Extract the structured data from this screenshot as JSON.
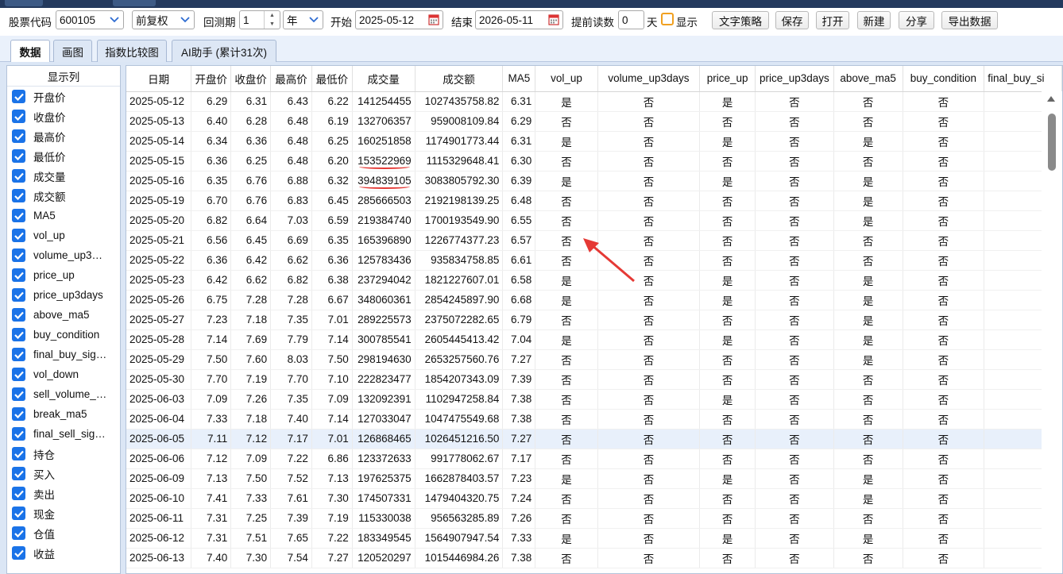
{
  "toolbar": {
    "stock_code_label": "股票代码",
    "stock_code_value": "600105",
    "adjust_value": "前复权",
    "period_label": "回测期",
    "period_num": "1",
    "period_unit": "年",
    "start_label": "开始",
    "start_date": "2025-05-12",
    "end_label": "结束",
    "end_date": "2026-05-11",
    "preread_label": "提前读数",
    "preread_value": "0",
    "day_label": "天",
    "show_label": "显示",
    "buttons": [
      "文字策略",
      "保存",
      "打开",
      "新建",
      "分享",
      "导出数据"
    ]
  },
  "tabs": [
    "数据",
    "画图",
    "指数比较图",
    "AI助手 (累计31次)"
  ],
  "sidebar": {
    "header": "显示列",
    "items": [
      "开盘价",
      "收盘价",
      "最高价",
      "最低价",
      "成交量",
      "成交额",
      "MA5",
      "vol_up",
      "volume_up3…",
      "price_up",
      "price_up3days",
      "above_ma5",
      "buy_condition",
      "final_buy_sig…",
      "vol_down",
      "sell_volume_…",
      "break_ma5",
      "final_sell_sig…",
      "持仓",
      "买入",
      "卖出",
      "现金",
      "仓值",
      "收益"
    ]
  },
  "table": {
    "headers": [
      "日期",
      "开盘价",
      "收盘价",
      "最高价",
      "最低价",
      "成交量",
      "成交额",
      "MA5",
      "vol_up",
      "volume_up3days",
      "price_up",
      "price_up3days",
      "above_ma5",
      "buy_condition",
      "final_buy_si"
    ],
    "rows": [
      [
        "2025-05-12",
        "6.29",
        "6.31",
        "6.43",
        "6.22",
        "141254455",
        "1027435758.82",
        "6.31",
        "是",
        "否",
        "是",
        "否",
        "否",
        "否"
      ],
      [
        "2025-05-13",
        "6.40",
        "6.28",
        "6.48",
        "6.19",
        "132706357",
        "959008109.84",
        "6.29",
        "否",
        "否",
        "否",
        "否",
        "否",
        "否"
      ],
      [
        "2025-05-14",
        "6.34",
        "6.36",
        "6.48",
        "6.25",
        "160251858",
        "1174901773.44",
        "6.31",
        "是",
        "否",
        "是",
        "否",
        "是",
        "否"
      ],
      [
        "2025-05-15",
        "6.36",
        "6.25",
        "6.48",
        "6.20",
        "153522969",
        "1115329648.41",
        "6.30",
        "否",
        "否",
        "否",
        "否",
        "否",
        "否"
      ],
      [
        "2025-05-16",
        "6.35",
        "6.76",
        "6.88",
        "6.32",
        "394839105",
        "3083805792.30",
        "6.39",
        "是",
        "否",
        "是",
        "否",
        "是",
        "否"
      ],
      [
        "2025-05-19",
        "6.70",
        "6.76",
        "6.83",
        "6.45",
        "285666503",
        "2192198139.25",
        "6.48",
        "否",
        "否",
        "否",
        "否",
        "是",
        "否"
      ],
      [
        "2025-05-20",
        "6.82",
        "6.64",
        "7.03",
        "6.59",
        "219384740",
        "1700193549.90",
        "6.55",
        "否",
        "否",
        "否",
        "否",
        "是",
        "否"
      ],
      [
        "2025-05-21",
        "6.56",
        "6.45",
        "6.69",
        "6.35",
        "165396890",
        "1226774377.23",
        "6.57",
        "否",
        "否",
        "否",
        "否",
        "否",
        "否"
      ],
      [
        "2025-05-22",
        "6.36",
        "6.42",
        "6.62",
        "6.36",
        "125783436",
        "935834758.85",
        "6.61",
        "否",
        "否",
        "否",
        "否",
        "否",
        "否"
      ],
      [
        "2025-05-23",
        "6.42",
        "6.62",
        "6.82",
        "6.38",
        "237294042",
        "1821227607.01",
        "6.58",
        "是",
        "否",
        "是",
        "否",
        "是",
        "否"
      ],
      [
        "2025-05-26",
        "6.75",
        "7.28",
        "7.28",
        "6.67",
        "348060361",
        "2854245897.90",
        "6.68",
        "是",
        "否",
        "是",
        "否",
        "是",
        "否"
      ],
      [
        "2025-05-27",
        "7.23",
        "7.18",
        "7.35",
        "7.01",
        "289225573",
        "2375072282.65",
        "6.79",
        "否",
        "否",
        "否",
        "否",
        "是",
        "否"
      ],
      [
        "2025-05-28",
        "7.14",
        "7.69",
        "7.79",
        "7.14",
        "300785541",
        "2605445413.42",
        "7.04",
        "是",
        "否",
        "是",
        "否",
        "是",
        "否"
      ],
      [
        "2025-05-29",
        "7.50",
        "7.60",
        "8.03",
        "7.50",
        "298194630",
        "2653257560.76",
        "7.27",
        "否",
        "否",
        "否",
        "否",
        "是",
        "否"
      ],
      [
        "2025-05-30",
        "7.70",
        "7.19",
        "7.70",
        "7.10",
        "222823477",
        "1854207343.09",
        "7.39",
        "否",
        "否",
        "否",
        "否",
        "否",
        "否"
      ],
      [
        "2025-06-03",
        "7.09",
        "7.26",
        "7.35",
        "7.09",
        "132092391",
        "1102947258.84",
        "7.38",
        "否",
        "否",
        "是",
        "否",
        "否",
        "否"
      ],
      [
        "2025-06-04",
        "7.33",
        "7.18",
        "7.40",
        "7.14",
        "127033047",
        "1047475549.68",
        "7.38",
        "否",
        "否",
        "否",
        "否",
        "否",
        "否"
      ],
      [
        "2025-06-05",
        "7.11",
        "7.12",
        "7.17",
        "7.01",
        "126868465",
        "1026451216.50",
        "7.27",
        "否",
        "否",
        "否",
        "否",
        "否",
        "否"
      ],
      [
        "2025-06-06",
        "7.12",
        "7.09",
        "7.22",
        "6.86",
        "123372633",
        "991778062.67",
        "7.17",
        "否",
        "否",
        "否",
        "否",
        "否",
        "否"
      ],
      [
        "2025-06-09",
        "7.13",
        "7.50",
        "7.52",
        "7.13",
        "197625375",
        "1662878403.57",
        "7.23",
        "是",
        "否",
        "是",
        "否",
        "是",
        "否"
      ],
      [
        "2025-06-10",
        "7.41",
        "7.33",
        "7.61",
        "7.30",
        "174507331",
        "1479404320.75",
        "7.24",
        "否",
        "否",
        "否",
        "否",
        "是",
        "否"
      ],
      [
        "2025-06-11",
        "7.31",
        "7.25",
        "7.39",
        "7.19",
        "115330038",
        "956563285.89",
        "7.26",
        "否",
        "否",
        "否",
        "否",
        "否",
        "否"
      ],
      [
        "2025-06-12",
        "7.31",
        "7.51",
        "7.65",
        "7.22",
        "183349545",
        "1564907947.54",
        "7.33",
        "是",
        "否",
        "是",
        "否",
        "是",
        "否"
      ],
      [
        "2025-06-13",
        "7.40",
        "7.30",
        "7.54",
        "7.27",
        "120520297",
        "1015446984.26",
        "7.38",
        "否",
        "否",
        "否",
        "否",
        "否",
        "否"
      ]
    ]
  },
  "colors": {
    "accent": "#1a73e8",
    "annotation": "#e53935",
    "panel_bg": "#dbe6f5",
    "top_bar": "#23395d"
  }
}
